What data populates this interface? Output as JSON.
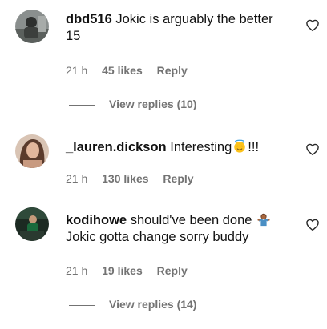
{
  "comments": [
    {
      "username": "dbd516",
      "text": "Jokic is arguably the better 15",
      "emoji": "",
      "text_after": "",
      "time": "21 h",
      "likes": "45 likes",
      "reply": "Reply",
      "view_replies": "View replies (10)"
    },
    {
      "username": "_lauren.dickson",
      "text": "Interesting",
      "emoji": "smiling-face-with-halo",
      "text_after": "!!!",
      "time": "21 h",
      "likes": "130 likes",
      "reply": "Reply",
      "view_replies": ""
    },
    {
      "username": "kodihowe",
      "text": "should've been done",
      "emoji": "person-shrugging",
      "text_after": "Jokic gotta change sorry buddy",
      "time": "21 h",
      "likes": "19 likes",
      "reply": "Reply",
      "view_replies": "View replies (14)"
    }
  ],
  "colors": {
    "meta_gray": "#737373",
    "text": "#111111",
    "background": "#ffffff"
  },
  "icons": {
    "like": "heart-outline-icon"
  }
}
